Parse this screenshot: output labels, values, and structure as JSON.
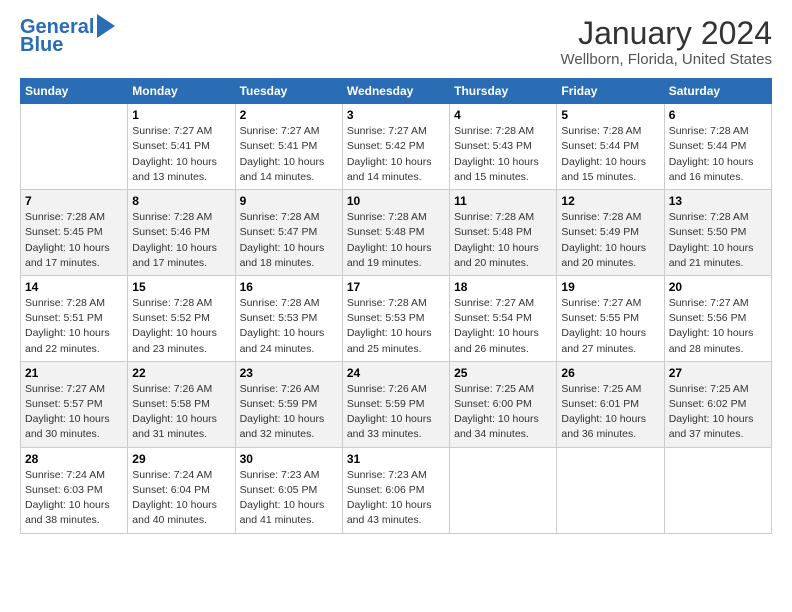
{
  "header": {
    "logo_line1": "General",
    "logo_line2": "Blue",
    "title": "January 2024",
    "subtitle": "Wellborn, Florida, United States"
  },
  "days_of_week": [
    "Sunday",
    "Monday",
    "Tuesday",
    "Wednesday",
    "Thursday",
    "Friday",
    "Saturday"
  ],
  "weeks": [
    [
      {
        "num": "",
        "detail": ""
      },
      {
        "num": "1",
        "detail": "Sunrise: 7:27 AM\nSunset: 5:41 PM\nDaylight: 10 hours\nand 13 minutes."
      },
      {
        "num": "2",
        "detail": "Sunrise: 7:27 AM\nSunset: 5:41 PM\nDaylight: 10 hours\nand 14 minutes."
      },
      {
        "num": "3",
        "detail": "Sunrise: 7:27 AM\nSunset: 5:42 PM\nDaylight: 10 hours\nand 14 minutes."
      },
      {
        "num": "4",
        "detail": "Sunrise: 7:28 AM\nSunset: 5:43 PM\nDaylight: 10 hours\nand 15 minutes."
      },
      {
        "num": "5",
        "detail": "Sunrise: 7:28 AM\nSunset: 5:44 PM\nDaylight: 10 hours\nand 15 minutes."
      },
      {
        "num": "6",
        "detail": "Sunrise: 7:28 AM\nSunset: 5:44 PM\nDaylight: 10 hours\nand 16 minutes."
      }
    ],
    [
      {
        "num": "7",
        "detail": "Sunrise: 7:28 AM\nSunset: 5:45 PM\nDaylight: 10 hours\nand 17 minutes."
      },
      {
        "num": "8",
        "detail": "Sunrise: 7:28 AM\nSunset: 5:46 PM\nDaylight: 10 hours\nand 17 minutes."
      },
      {
        "num": "9",
        "detail": "Sunrise: 7:28 AM\nSunset: 5:47 PM\nDaylight: 10 hours\nand 18 minutes."
      },
      {
        "num": "10",
        "detail": "Sunrise: 7:28 AM\nSunset: 5:48 PM\nDaylight: 10 hours\nand 19 minutes."
      },
      {
        "num": "11",
        "detail": "Sunrise: 7:28 AM\nSunset: 5:48 PM\nDaylight: 10 hours\nand 20 minutes."
      },
      {
        "num": "12",
        "detail": "Sunrise: 7:28 AM\nSunset: 5:49 PM\nDaylight: 10 hours\nand 20 minutes."
      },
      {
        "num": "13",
        "detail": "Sunrise: 7:28 AM\nSunset: 5:50 PM\nDaylight: 10 hours\nand 21 minutes."
      }
    ],
    [
      {
        "num": "14",
        "detail": "Sunrise: 7:28 AM\nSunset: 5:51 PM\nDaylight: 10 hours\nand 22 minutes."
      },
      {
        "num": "15",
        "detail": "Sunrise: 7:28 AM\nSunset: 5:52 PM\nDaylight: 10 hours\nand 23 minutes."
      },
      {
        "num": "16",
        "detail": "Sunrise: 7:28 AM\nSunset: 5:53 PM\nDaylight: 10 hours\nand 24 minutes."
      },
      {
        "num": "17",
        "detail": "Sunrise: 7:28 AM\nSunset: 5:53 PM\nDaylight: 10 hours\nand 25 minutes."
      },
      {
        "num": "18",
        "detail": "Sunrise: 7:27 AM\nSunset: 5:54 PM\nDaylight: 10 hours\nand 26 minutes."
      },
      {
        "num": "19",
        "detail": "Sunrise: 7:27 AM\nSunset: 5:55 PM\nDaylight: 10 hours\nand 27 minutes."
      },
      {
        "num": "20",
        "detail": "Sunrise: 7:27 AM\nSunset: 5:56 PM\nDaylight: 10 hours\nand 28 minutes."
      }
    ],
    [
      {
        "num": "21",
        "detail": "Sunrise: 7:27 AM\nSunset: 5:57 PM\nDaylight: 10 hours\nand 30 minutes."
      },
      {
        "num": "22",
        "detail": "Sunrise: 7:26 AM\nSunset: 5:58 PM\nDaylight: 10 hours\nand 31 minutes."
      },
      {
        "num": "23",
        "detail": "Sunrise: 7:26 AM\nSunset: 5:59 PM\nDaylight: 10 hours\nand 32 minutes."
      },
      {
        "num": "24",
        "detail": "Sunrise: 7:26 AM\nSunset: 5:59 PM\nDaylight: 10 hours\nand 33 minutes."
      },
      {
        "num": "25",
        "detail": "Sunrise: 7:25 AM\nSunset: 6:00 PM\nDaylight: 10 hours\nand 34 minutes."
      },
      {
        "num": "26",
        "detail": "Sunrise: 7:25 AM\nSunset: 6:01 PM\nDaylight: 10 hours\nand 36 minutes."
      },
      {
        "num": "27",
        "detail": "Sunrise: 7:25 AM\nSunset: 6:02 PM\nDaylight: 10 hours\nand 37 minutes."
      }
    ],
    [
      {
        "num": "28",
        "detail": "Sunrise: 7:24 AM\nSunset: 6:03 PM\nDaylight: 10 hours\nand 38 minutes."
      },
      {
        "num": "29",
        "detail": "Sunrise: 7:24 AM\nSunset: 6:04 PM\nDaylight: 10 hours\nand 40 minutes."
      },
      {
        "num": "30",
        "detail": "Sunrise: 7:23 AM\nSunset: 6:05 PM\nDaylight: 10 hours\nand 41 minutes."
      },
      {
        "num": "31",
        "detail": "Sunrise: 7:23 AM\nSunset: 6:06 PM\nDaylight: 10 hours\nand 43 minutes."
      },
      {
        "num": "",
        "detail": ""
      },
      {
        "num": "",
        "detail": ""
      },
      {
        "num": "",
        "detail": ""
      }
    ]
  ]
}
